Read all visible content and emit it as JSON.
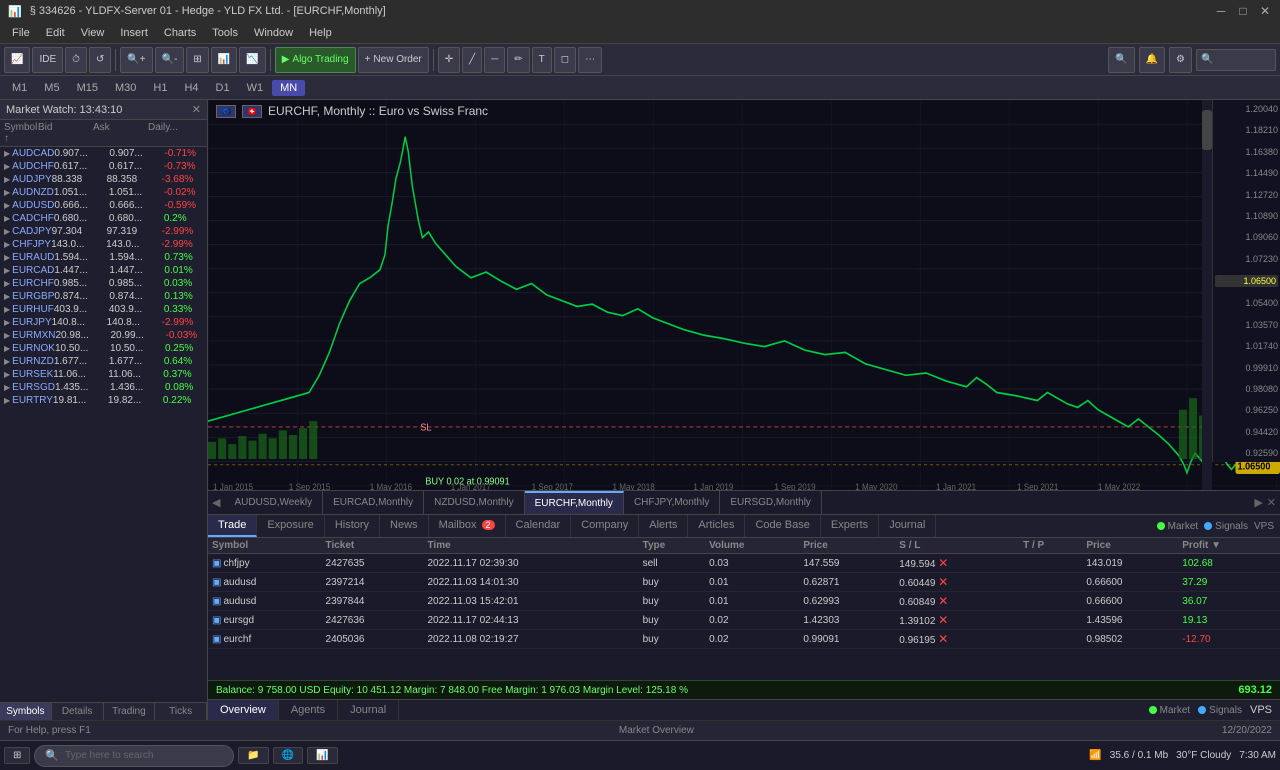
{
  "titleBar": {
    "title": "§ 334626 - YLDFX-Server 01 - Hedge - YLD FX Ltd. - [EURCHF,Monthly]",
    "buttons": [
      "minimize",
      "maximize",
      "close"
    ]
  },
  "menuBar": {
    "items": [
      "File",
      "Edit",
      "View",
      "Insert",
      "Charts",
      "Tools",
      "Window",
      "Help"
    ]
  },
  "toolbar": {
    "buttons": [
      "IDE",
      "timer",
      "refresh",
      "algo_trading",
      "new_order"
    ],
    "algoTrading": "Algo Trading",
    "newOrder": "New Order"
  },
  "timeframes": {
    "buttons": [
      "M1",
      "M5",
      "M15",
      "M30",
      "H1",
      "H4",
      "D1",
      "W1",
      "MN"
    ]
  },
  "marketWatch": {
    "title": "Market Watch: 13:43:10",
    "columns": [
      "Symbol",
      "Bid",
      "Ask",
      "Daily..."
    ],
    "tabs": [
      "Symbols",
      "Details",
      "Trading",
      "Ticks"
    ],
    "rows": [
      {
        "symbol": "AUDCAD",
        "bid": "0.907...",
        "ask": "0.907...",
        "daily": "-0.71%"
      },
      {
        "symbol": "AUDCHF",
        "bid": "0.617...",
        "ask": "0.617...",
        "daily": "-0.73%"
      },
      {
        "symbol": "AUDJPY",
        "bid": "88.338",
        "ask": "88.358",
        "daily": "-3.68%"
      },
      {
        "symbol": "AUDNZD",
        "bid": "1.051...",
        "ask": "1.051...",
        "daily": "-0.02%"
      },
      {
        "symbol": "AUDUSD",
        "bid": "0.666...",
        "ask": "0.666...",
        "daily": "-0.59%"
      },
      {
        "symbol": "CADCHF",
        "bid": "0.680...",
        "ask": "0.680...",
        "daily": "0.2%"
      },
      {
        "symbol": "CADJPY",
        "bid": "97.304",
        "ask": "97.319",
        "daily": "-2.99%"
      },
      {
        "symbol": "CHFJPY",
        "bid": "143.0...",
        "ask": "143.0...",
        "daily": "-2.99%"
      },
      {
        "symbol": "EURAUD",
        "bid": "1.594...",
        "ask": "1.594...",
        "daily": "0.73%"
      },
      {
        "symbol": "EURCAD",
        "bid": "1.447...",
        "ask": "1.447...",
        "daily": "0.01%"
      },
      {
        "symbol": "EURCHF",
        "bid": "0.985...",
        "ask": "0.985...",
        "daily": "0.03%"
      },
      {
        "symbol": "EURGBP",
        "bid": "0.874...",
        "ask": "0.874...",
        "daily": "0.13%"
      },
      {
        "symbol": "EURHUF",
        "bid": "403.9...",
        "ask": "403.9...",
        "daily": "0.33%"
      },
      {
        "symbol": "EURJPY",
        "bid": "140.8...",
        "ask": "140.8...",
        "daily": "-2.99%"
      },
      {
        "symbol": "EURMXN",
        "bid": "20.98...",
        "ask": "20.99...",
        "daily": "-0.03%"
      },
      {
        "symbol": "EURNOK",
        "bid": "10.50...",
        "ask": "10.50...",
        "daily": "0.25%"
      },
      {
        "symbol": "EURNZD",
        "bid": "1.677...",
        "ask": "1.677...",
        "daily": "0.64%"
      },
      {
        "symbol": "EURSEK",
        "bid": "11.06...",
        "ask": "11.06...",
        "daily": "0.37%"
      },
      {
        "symbol": "EURSGD",
        "bid": "1.435...",
        "ask": "1.436...",
        "daily": "0.08%"
      },
      {
        "symbol": "EURTRY",
        "bid": "19.81...",
        "ask": "19.82...",
        "daily": "0.22%"
      }
    ]
  },
  "chart": {
    "flag1": "EU",
    "flag2": "CH",
    "instrument": "EURCHF, Monthly :: Euro vs Swiss Franc",
    "annotation": "BUY 0.02 at 0.99091",
    "slAnnotation": "SL",
    "priceLabels": [
      "1.20040",
      "1.18210",
      "1.16380",
      "1.14490",
      "1.12720",
      "1.10890",
      "1.09060",
      "1.07230",
      "1.05400",
      "1.03570",
      "1.01740",
      "0.99910",
      "0.98080",
      "0.96250",
      "0.94420",
      "0.92590"
    ],
    "highlightPrice": "1.06500",
    "tabs": [
      "AUDUSD,Weekly",
      "EURCAD,Monthly",
      "NZDUSD,Monthly",
      "EURCHF,Monthly",
      "CHFJPY,Monthly",
      "EURSGD,Monthly"
    ],
    "activeTab": "EURCHF,Monthly",
    "xLabels": [
      "1 Jan 2015",
      "1 Sep 2015",
      "1 May 2016",
      "1 Jan 2017",
      "1 Sep 2017",
      "1 May 2018",
      "1 Jan 2019",
      "1 Sep 2019",
      "1 May 2020",
      "1 Jan 2021",
      "1 Sep 2021",
      "1 May 2022"
    ]
  },
  "trades": {
    "columns": [
      "Symbol",
      "Ticket",
      "Time",
      "Type",
      "Volume",
      "Price",
      "S / L",
      "T / P",
      "Price",
      "Profit"
    ],
    "rows": [
      {
        "symbol": "chfjpy",
        "ticket": "2427635",
        "time": "2022.11.17 02:39:30",
        "type": "sell",
        "volume": "0.03",
        "price": "147.559",
        "sl": "149.594",
        "tp": "",
        "closeprice": "143.019",
        "profit": "102.68",
        "profitType": "pos"
      },
      {
        "symbol": "audusd",
        "ticket": "2397214",
        "time": "2022.11.03 14:01:30",
        "type": "buy",
        "volume": "0.01",
        "price": "0.62871",
        "sl": "0.60449",
        "tp": "",
        "closeprice": "0.66600",
        "profit": "37.29",
        "profitType": "pos"
      },
      {
        "symbol": "audusd",
        "ticket": "2397844",
        "time": "2022.11.03 15:42:01",
        "type": "buy",
        "volume": "0.01",
        "price": "0.62993",
        "sl": "0.60849",
        "tp": "",
        "closeprice": "0.66600",
        "profit": "36.07",
        "profitType": "pos"
      },
      {
        "symbol": "eursgd",
        "ticket": "2427636",
        "time": "2022.11.17 02:44:13",
        "type": "buy",
        "volume": "0.02",
        "price": "1.42303",
        "sl": "1.39102",
        "tp": "",
        "closeprice": "1.43596",
        "profit": "19.13",
        "profitType": "pos"
      },
      {
        "symbol": "eurchf",
        "ticket": "2405036",
        "time": "2022.11.08 02:19:27",
        "type": "buy",
        "volume": "0.02",
        "price": "0.99091",
        "sl": "0.96195",
        "tp": "",
        "closeprice": "0.98502",
        "profit": "-12.70",
        "profitType": "neg"
      }
    ],
    "totalProfit": "693.12",
    "balanceText": "Balance: 9 758.00 USD  Equity: 10 451.12  Margin: 7 848.00  Free Margin: 1 976.03  Margin Level: 125.18 %"
  },
  "bottomTabs": {
    "tabs": [
      "Trade",
      "Exposure",
      "History",
      "News",
      "Mailbox",
      "Calendar",
      "Company",
      "Alerts",
      "Articles",
      "Code Base",
      "Experts",
      "Journal"
    ],
    "activeTab": "Trade",
    "mailboxBadge": "2"
  },
  "subTabs": {
    "tabs": [
      "Overview",
      "Agents",
      "Journal"
    ],
    "activeTab": "Overview"
  },
  "statusBar": {
    "helpText": "For Help, press F1",
    "marketText": "Market Overview",
    "rightStatus": [
      "Market",
      "Signals",
      "VPS"
    ]
  },
  "taskbar": {
    "startLabel": "⊞",
    "searchPlaceholder": "Type here to search",
    "time": "7:30 AM",
    "weather": "30°F  Cloudy",
    "network": "35.6 / 0.1 Mb"
  }
}
